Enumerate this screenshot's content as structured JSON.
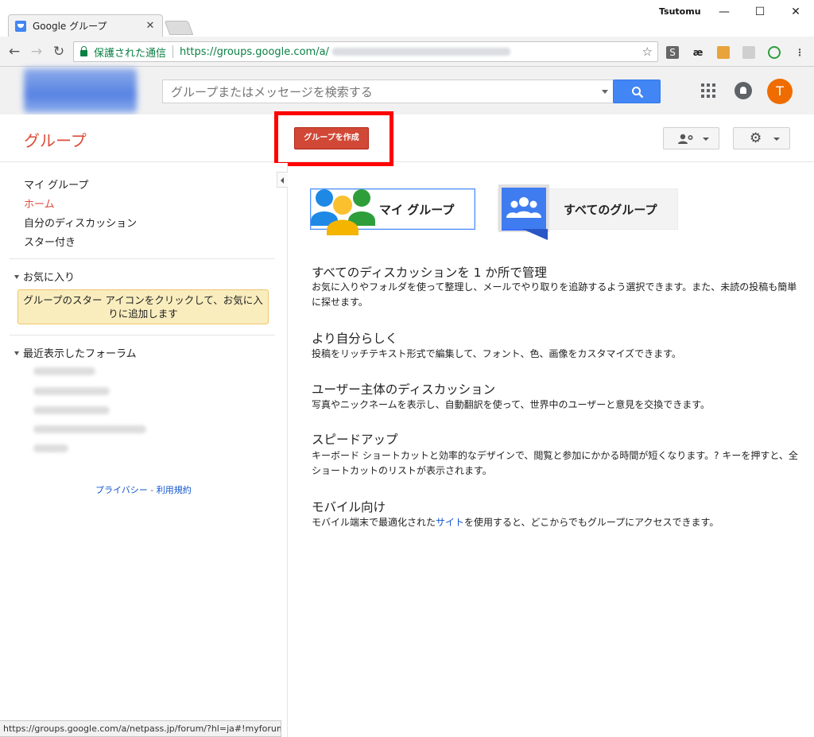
{
  "browser": {
    "tab_title": "Google グループ",
    "profile_name": "Tsutomu",
    "secure_label": "保護された通信",
    "url_visible": "https://groups.google.com/a/",
    "status_url": "https://groups.google.com/a/netpass.jp/forum/?hl=ja#!myforums"
  },
  "header": {
    "search_placeholder": "グループまたはメッセージを検索する",
    "avatar_letter": "T"
  },
  "groups_bar": {
    "title": "グループ",
    "create_button": "グループを作成"
  },
  "sidebar": {
    "nav": [
      {
        "label": "マイ グループ",
        "active": false
      },
      {
        "label": "ホーム",
        "active": true
      },
      {
        "label": "自分のディスカッション",
        "active": false
      },
      {
        "label": "スター付き",
        "active": false
      }
    ],
    "favorites_heading": "お気に入り",
    "favorites_note": "グループのスター アイコンをクリックして、お気に入りに追加します",
    "recent_heading": "最近表示したフォーラム",
    "privacy": "プライバシー",
    "terms": "利用規約"
  },
  "main": {
    "my_groups_card": "マイ グループ",
    "all_groups_card": "すべてのグループ",
    "features": [
      {
        "title": "すべてのディスカッションを 1 か所で管理",
        "desc": "お気に入りやフォルダを使って整理し、メールでやり取りを追跡するよう選択できます。また、未読の投稿も簡単に探せます。"
      },
      {
        "title": "より自分らしく",
        "desc": "投稿をリッチテキスト形式で編集して、フォント、色、画像をカスタマイズできます。"
      },
      {
        "title": "ユーザー主体のディスカッション",
        "desc": "写真やニックネームを表示し、自動翻訳を使って、世界中のユーザーと意見を交換できます。"
      },
      {
        "title": "スピードアップ",
        "desc": "キーボード ショートカットと効率的なデザインで、閲覧と参加にかかる時間が短くなります。? キーを押すと、全ショートカットのリストが表示されます。"
      },
      {
        "title": "モバイル向け",
        "desc_before": "モバイル端末で最適化された",
        "desc_link": "サイト",
        "desc_after": "を使用すると、どこからでもグループにアクセスできます。"
      }
    ]
  },
  "colors": {
    "brand_red": "#dd4b39",
    "create_button": "#d14836",
    "highlight": "#ff0000",
    "search_blue": "#4285f4",
    "link": "#1155cc",
    "avatar": "#ef6c00"
  }
}
